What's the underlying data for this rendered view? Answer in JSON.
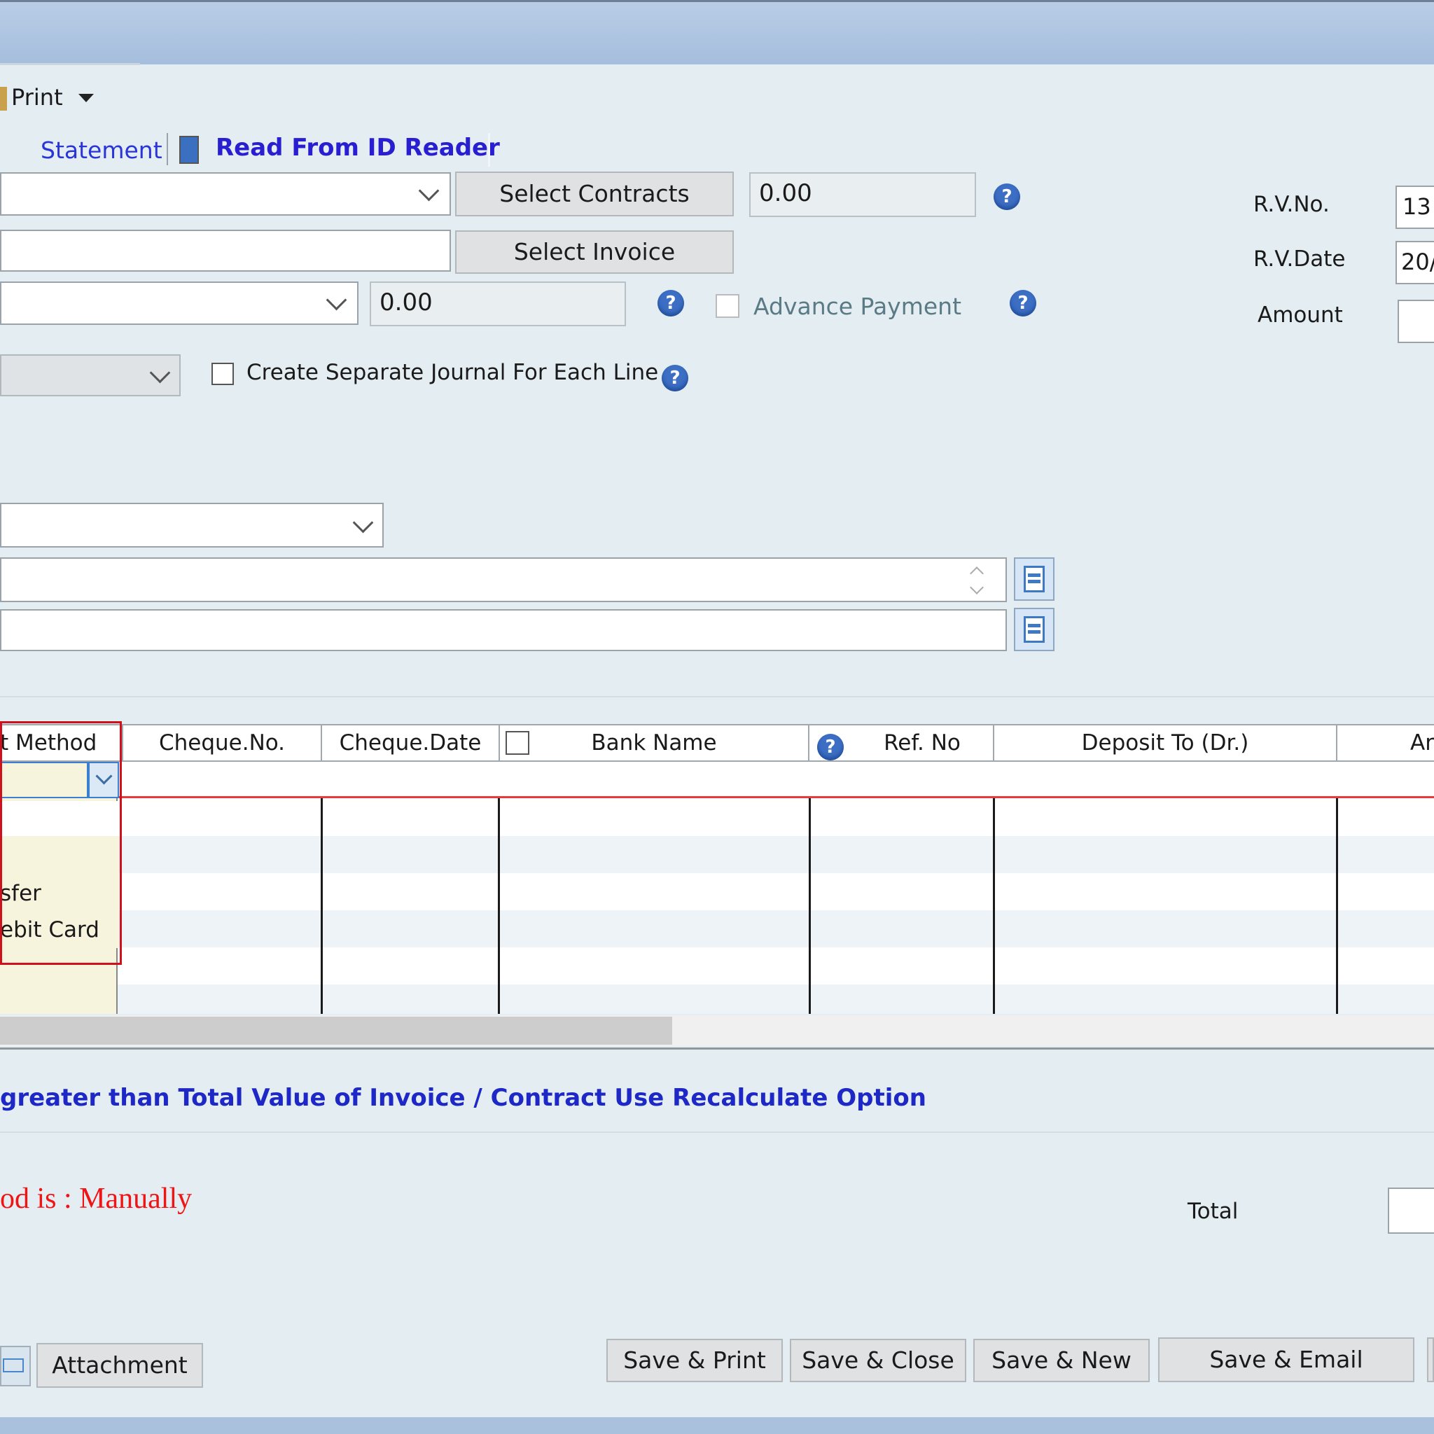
{
  "toolbar": {
    "print_label": "Print",
    "statement_label": "Statement",
    "read_id_label": "Read From ID Reader"
  },
  "form": {
    "select_contracts_label": "Select Contracts",
    "contracts_amount": "0.00",
    "select_invoice_label": "Select Invoice",
    "invoice_amount": "0.00",
    "advance_payment_label": "Advance Payment",
    "separate_journal_label": "Create Separate Journal For Each Line",
    "help_glyph": "?"
  },
  "header_right": {
    "rv_no_label": "R.V.No.",
    "rv_no_value": "13",
    "rv_date_label": "R.V.Date",
    "rv_date_value": "20/(",
    "amount_label": "Amount"
  },
  "grid": {
    "columns": [
      "t Method",
      "Cheque.No.",
      "Cheque.Date",
      "Bank Name",
      "Ref. No",
      "Deposit To (Dr.)",
      "Ar"
    ],
    "dropdown_items": [
      "sfer",
      "ebit Card"
    ]
  },
  "messages": {
    "info": "greater than Total Value of Invoice / Contract Use Recalculate Option",
    "method": "od is : Manually",
    "total_label": "Total"
  },
  "footer": {
    "attachment_label": "Attachment",
    "save_print_label": "Save & Print",
    "save_close_label": "Save & Close",
    "save_new_label": "Save & New",
    "save_email_label": "Save & Email"
  },
  "colors": {
    "accent_blue": "#2a35d8",
    "error_red": "#f01414",
    "highlight_red": "#d0101a"
  }
}
